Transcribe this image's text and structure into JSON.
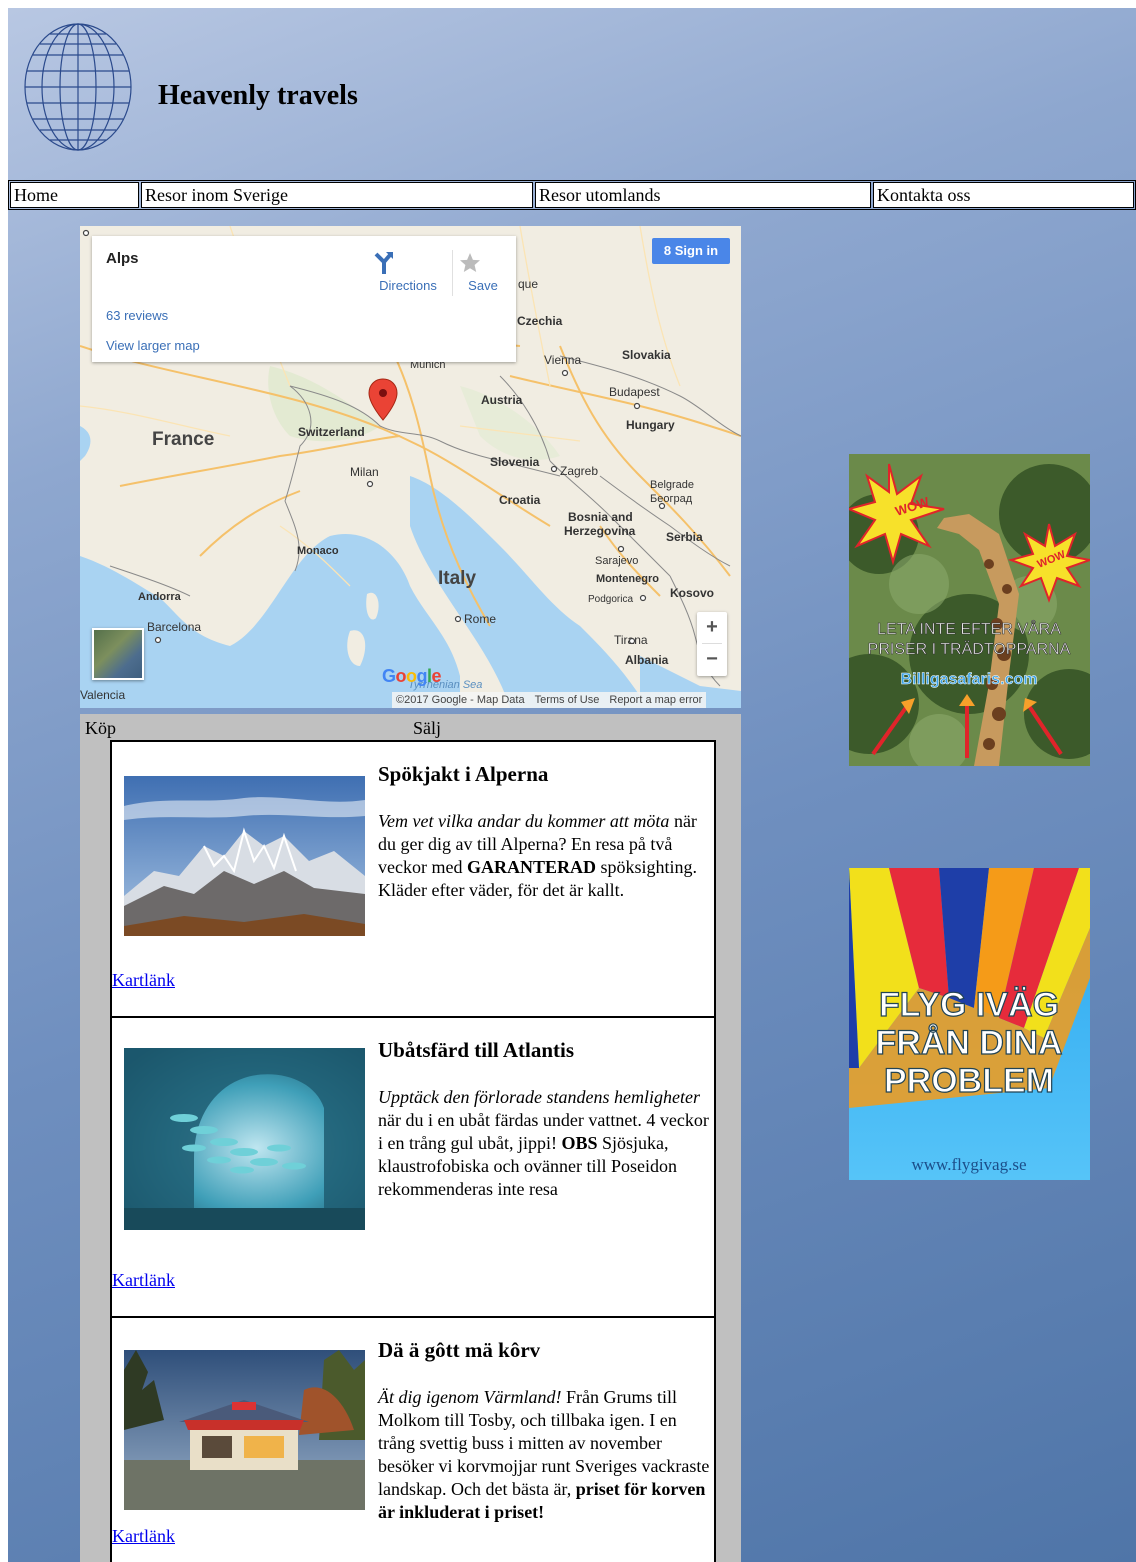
{
  "header": {
    "title": "Heavenly travels"
  },
  "nav": {
    "items": [
      {
        "label": "Home"
      },
      {
        "label": "Resor inom Sverige"
      },
      {
        "label": "Resor utomlands"
      },
      {
        "label": "Kontakta oss"
      }
    ]
  },
  "map": {
    "place_name": "Alps",
    "reviews": "63 reviews",
    "larger_map": "View larger map",
    "directions": "Directions",
    "save": "Save",
    "sign_in": "Sign in",
    "zoom_in": "+",
    "zoom_out": "−",
    "google": "Google",
    "footer": {
      "copyright": "©2017 Google - Map Data",
      "terms": "Terms of Use",
      "report": "Report a map error"
    },
    "labels": {
      "france": "France",
      "switzerland": "Switzerland",
      "austria": "Austria",
      "hungary": "Hungary",
      "italy": "Italy",
      "slovenia": "Slovenia",
      "croatia": "Croatia",
      "bosnia1": "Bosnia and",
      "bosnia2": "Herzegovina",
      "serbia": "Serbia",
      "slovakia": "Slovakia",
      "czechia": "Czechia",
      "vienna": "Vienna",
      "budapest": "Budapest",
      "zagreb": "Zagreb",
      "belgrade1": "Belgrade",
      "belgrade2": "Београд",
      "sarajevo": "Sarajevo",
      "montenegro": "Montenegro",
      "kosovo": "Kosovo",
      "podgorica": "Podgorica",
      "tirana": "Tirana",
      "albania": "Albania",
      "milan": "Milan",
      "munich": "Munich",
      "monaco": "Monaco",
      "andorra": "Andorra",
      "barcelona": "Barcelona",
      "valencia": "Valencia",
      "rome": "Rome",
      "tyrrhenian": "Tyrrhenian Sea",
      "que": "que"
    }
  },
  "panel": {
    "tab_buy": "Köp",
    "tab_sell": "Sälj",
    "trips": [
      {
        "title": "Spökjakt i Alperna",
        "intro_italic": "Vem vet vilka andar du kommer att möta",
        "text_1": " när du ger dig av till Alperna? En resa på två veckor med ",
        "bold_1": "GARANTERAD",
        "text_2": " spöksighting. Kläder efter väder, för det är kallt.",
        "link": "Kartlänk"
      },
      {
        "title": "Ubåtsfärd till Atlantis",
        "intro_italic": "Upptäck den förlorade standens hemligheter",
        "text_1": " när du i en ubåt färdas under vattnet. 4 veckor i en trång gul ubåt, jippi! ",
        "bold_1": "OBS",
        "text_2": " Sjösjuka, klaustrofobiska och ovänner till Poseidon rekommenderas inte resa",
        "link": "Kartlänk"
      },
      {
        "title": "Dä ä gôtt mä kôrv",
        "intro_italic": "Ät dig igenom Värmland!",
        "text_1": " Från Grums till Molkom till Tosby, och tillbaka igen. I en trång svettig buss i mitten av november besöker vi korvmojjar runt Sveriges vackraste landskap. Och det bästa är, ",
        "bold_1": "priset för korven är inkluderat i priset!",
        "text_2": "",
        "link": "Kartlänk"
      }
    ]
  },
  "ads": {
    "safari": {
      "wow1": "WOW",
      "wow2": "WOW",
      "line1": "LETA INTE EFTER VÅRA",
      "line2": "PRISER I TRÄDTOPPARNA",
      "site": "Billigasafaris.com"
    },
    "balloon": {
      "line1": "FLYG IVÄG",
      "line2": "FRÅN DINA",
      "line3": "PROBLEM",
      "site": "www.flygivag.se"
    }
  }
}
